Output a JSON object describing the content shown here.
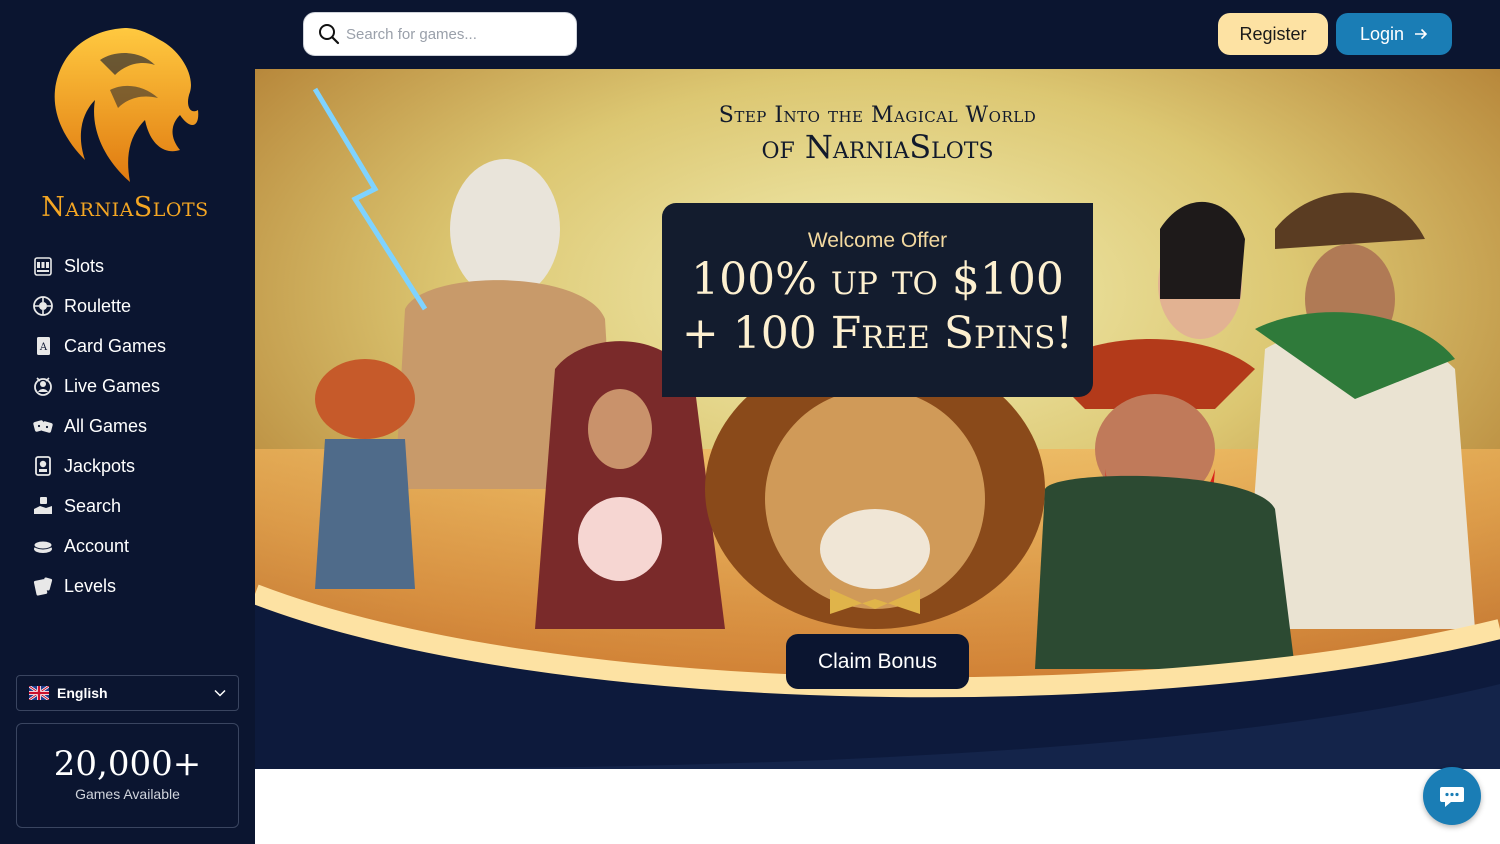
{
  "brand": {
    "name": "NarniaSlots"
  },
  "search": {
    "placeholder": "Search for games..."
  },
  "header": {
    "register_label": "Register",
    "login_label": "Login"
  },
  "sidebar": {
    "items": [
      {
        "label": "Slots",
        "icon": "slot-machine-icon"
      },
      {
        "label": "Roulette",
        "icon": "roulette-icon"
      },
      {
        "label": "Card Games",
        "icon": "playing-card-icon"
      },
      {
        "label": "Live Games",
        "icon": "live-dealer-icon"
      },
      {
        "label": "All Games",
        "icon": "dice-icon"
      },
      {
        "label": "Jackpots",
        "icon": "jackpot-icon"
      },
      {
        "label": "Search",
        "icon": "chips-hand-icon"
      },
      {
        "label": "Account",
        "icon": "coins-icon"
      },
      {
        "label": "Levels",
        "icon": "cards-icon"
      }
    ],
    "language": "English",
    "games_count": "20,000+",
    "games_label": "Games Available"
  },
  "hero": {
    "heading_line1": "Step Into the Magical World",
    "heading_line2": "of NarniaSlots",
    "offer_label": "Welcome Offer",
    "offer_line1": "100% up to $100",
    "offer_line2": "+ 100 Free Spins!",
    "cta_label": "Claim Bonus"
  },
  "colors": {
    "background": "#0b1530",
    "accent_gold": "#f4a623",
    "login_blue": "#1a7db5",
    "register_cream": "#fde2a3"
  }
}
